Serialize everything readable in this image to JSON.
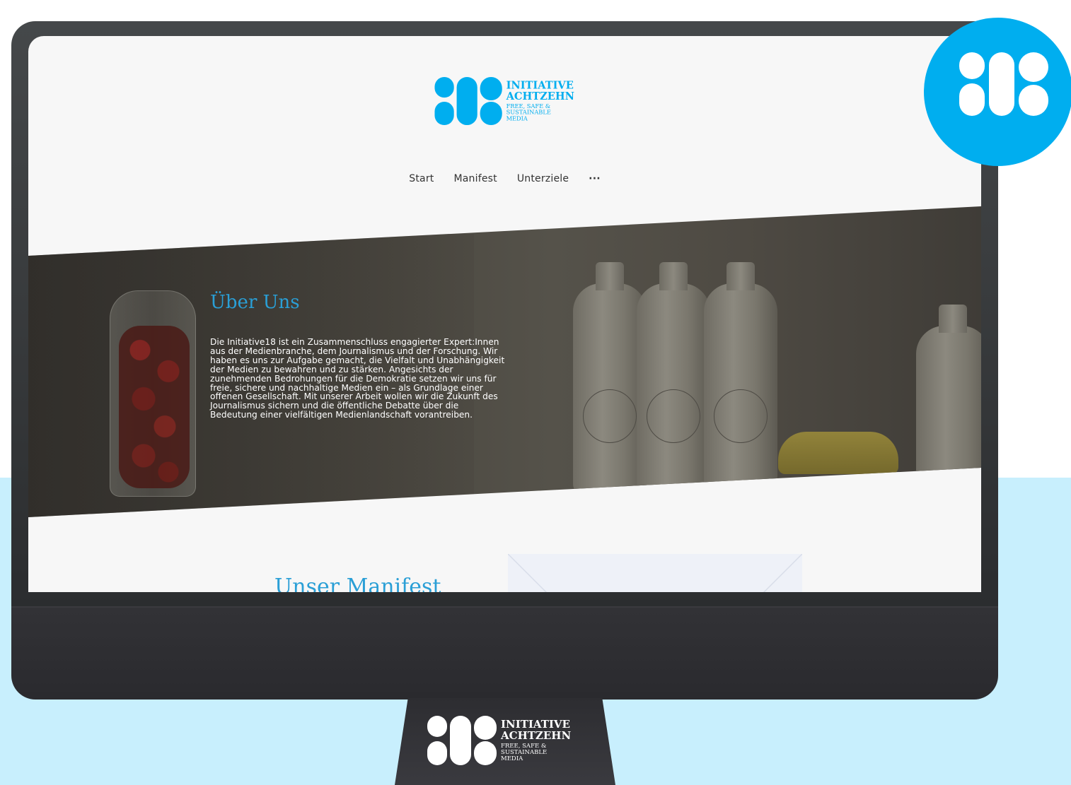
{
  "brand": {
    "name_line1": "INITIATIVE",
    "name_line2": "ACHTZEHN",
    "tagline_line1": "FREE, SAFE &",
    "tagline_line2": "SUSTAINABLE",
    "tagline_line3": "MEDIA",
    "color": "#00aeef"
  },
  "nav": {
    "items": [
      {
        "label": "Start"
      },
      {
        "label": "Manifest"
      },
      {
        "label": "Unterziele"
      }
    ],
    "more_label": "···"
  },
  "hero": {
    "title": "Über Uns",
    "text": "Die Initiative18 ist ein Zusammenschluss engagierter Expert:Innen aus der Medienbranche, dem Journalismus und der Forschung. Wir haben es uns zur Aufgabe gemacht, die Vielfalt und Unabhängigkeit der Medien zu bewahren und zu stärken. Angesichts der zunehmenden Bedrohungen für die Demokratie setzen wir uns für freie, sichere und nachhaltige Medien ein – als Grundlage einer offenen Gesellschaft. Mit unserer Arbeit wollen wir die Zukunft des Journalismus sichern und die öffentliche Debatte über die Bedeutung einer vielfältigen Medienlandschaft vorantreiben."
  },
  "manifest": {
    "title": "Unser Manifest"
  },
  "colors": {
    "accent": "#2a9fd6",
    "light_background": "#c8effd",
    "monitor": "#2d2d31"
  },
  "icons": {
    "logo": "initiative-18-logo-icon"
  }
}
